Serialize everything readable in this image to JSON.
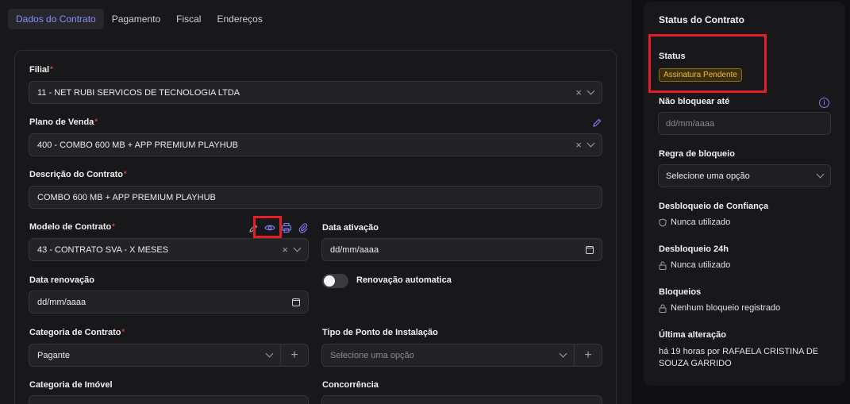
{
  "tabs": [
    {
      "label": "Dados do Contrato",
      "active": true
    },
    {
      "label": "Pagamento",
      "active": false
    },
    {
      "label": "Fiscal",
      "active": false
    },
    {
      "label": "Endereços",
      "active": false
    }
  ],
  "form": {
    "filial": {
      "label": "Filial",
      "required_mark": "*",
      "value": "11 - NET RUBI SERVICOS DE TECNOLOGIA LTDA"
    },
    "plano": {
      "label": "Plano de Venda",
      "required_mark": "*",
      "value": "400 - COMBO 600 MB + APP PREMIUM PLAYHUB"
    },
    "descricao": {
      "label": "Descrição do Contrato",
      "required_mark": "*",
      "value": "COMBO 600 MB + APP PREMIUM PLAYHUB"
    },
    "modelo": {
      "label": "Modelo de Contrato",
      "required_mark": "*",
      "value": "43 - CONTRATO SVA - X MESES"
    },
    "data_ativacao": {
      "label": "Data ativação",
      "placeholder": "dd/mm/aaaa"
    },
    "data_renovacao": {
      "label": "Data renovação",
      "placeholder": "dd/mm/aaaa"
    },
    "renovacao_auto": {
      "label": "Renovação automatica",
      "on": false
    },
    "categoria_contrato": {
      "label": "Categoria de Contrato",
      "required_mark": "*",
      "value": "Pagante"
    },
    "tipo_ponto": {
      "label": "Tipo de Ponto de Instalação",
      "placeholder": "Selecione uma opção"
    },
    "categoria_imovel": {
      "label": "Categoria de Imóvel"
    },
    "concorrencia": {
      "label": "Concorrência"
    },
    "clear_glyph": "×",
    "plus_glyph": "+"
  },
  "status_panel": {
    "title": "Status do Contrato",
    "status_label": "Status",
    "status_badge": "Assinatura Pendente",
    "nao_bloquear_label": "Não bloquear até",
    "nao_bloquear_placeholder": "dd/mm/aaaa",
    "info_glyph": "i",
    "regra_label": "Regra de bloqueio",
    "regra_value": "Selecione uma opção",
    "desbloqueio_confianca_label": "Desbloqueio de Confiança",
    "desbloqueio_confianca_value": "Nunca utilizado",
    "desbloqueio_24h_label": "Desbloqueio 24h",
    "desbloqueio_24h_value": "Nunca utilizado",
    "bloqueios_label": "Bloqueios",
    "bloqueios_value": "Nenhum bloqueio registrado",
    "ultima_label": "Última alteração",
    "ultima_value": "há 19 horas por RAFAELA CRISTINA DE SOUZA GARRIDO"
  },
  "colors": {
    "accent": "#8b8cf7",
    "highlight_box": "#e51d25",
    "badge_text": "#f3b935",
    "required": "#e04848"
  }
}
